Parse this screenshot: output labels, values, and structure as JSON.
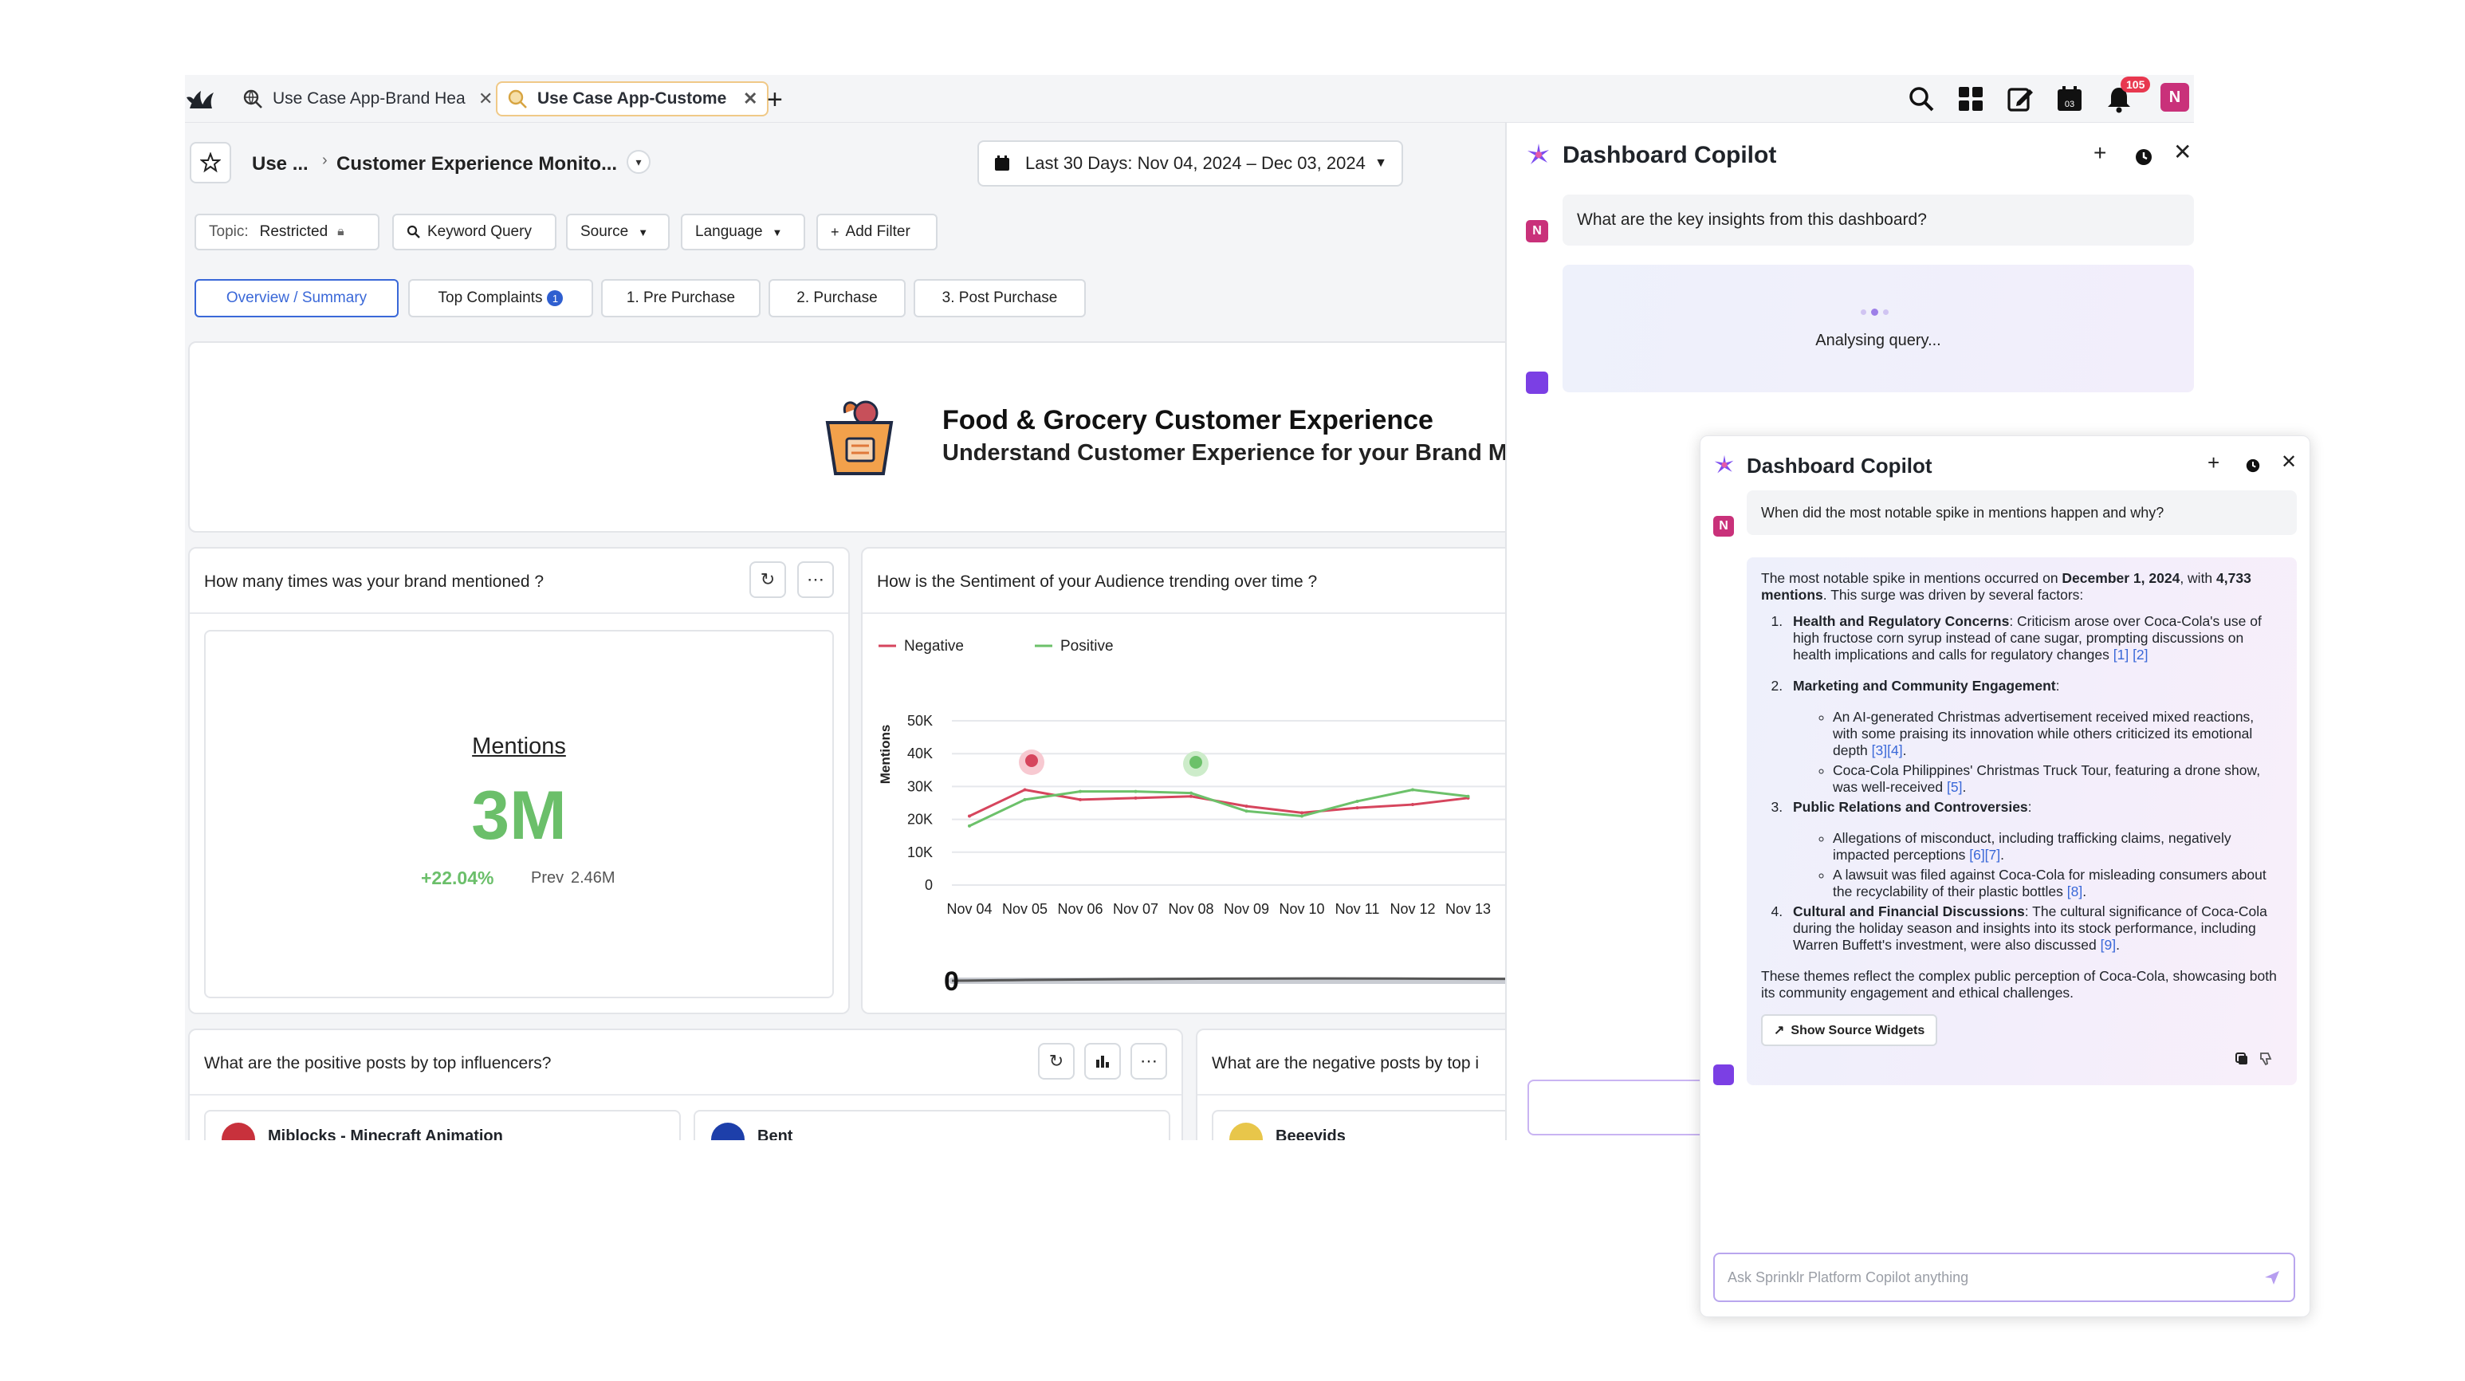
{
  "tabs": [
    {
      "label": "Use Case App-Brand Hea",
      "active": false
    },
    {
      "label": "Use Case App-Custome",
      "active": true
    }
  ],
  "top": {
    "notif_count": "105",
    "avatar": "N",
    "calendar_day": "03"
  },
  "header": {
    "crumb_short": "Use ...",
    "crumb_sep": "›",
    "dashboard_name": "Customer Experience Monito...",
    "date_range": "Last 30 Days: Nov 04, 2024 – Dec 03, 2024"
  },
  "filters": {
    "topic_label": "Topic:",
    "topic_value": "Restricted",
    "keyword": "Keyword Query",
    "source": "Source",
    "language": "Language",
    "add_filter": "Add Filter"
  },
  "view_tabs": [
    {
      "label": "Overview / Summary"
    },
    {
      "label": "Top Complaints",
      "count": "1"
    },
    {
      "label": "1. Pre Purchase"
    },
    {
      "label": "2. Purchase"
    },
    {
      "label": "3. Post Purchase"
    }
  ],
  "banner": {
    "title": "Food & Grocery Customer Experience",
    "subtitle": "Understand Customer Experience for your Brand Me"
  },
  "mentions_card": {
    "title": "How many times was your brand mentioned ?",
    "label": "Mentions",
    "value": "3M",
    "change": "+22.04%",
    "prev_label": "Prev",
    "prev_value": "2.46M"
  },
  "sentiment_card": {
    "title": "How is the Sentiment of your Audience trending over time ?"
  },
  "chart_data": {
    "type": "line",
    "title": "",
    "ylabel": "Mentions",
    "xlabel": "",
    "x": [
      "Nov 04",
      "Nov 05",
      "Nov 06",
      "Nov 07",
      "Nov 08",
      "Nov 09",
      "Nov 10",
      "Nov 11",
      "Nov 12",
      "Nov 13"
    ],
    "ylim": [
      0,
      50000
    ],
    "yticks": [
      "50K",
      "40K",
      "30K",
      "20K",
      "10K",
      "0"
    ],
    "series": [
      {
        "name": "Negative",
        "color": "#d6455d",
        "values": [
          21000,
          29000,
          26000,
          26500,
          27000,
          24000,
          22000,
          23500,
          24500,
          26500
        ]
      },
      {
        "name": "Positive",
        "color": "#6cc16a",
        "values": [
          18000,
          26000,
          28500,
          28500,
          28000,
          22500,
          21000,
          25500,
          29000,
          27000
        ]
      }
    ],
    "range_slider_label": "0"
  },
  "positive_card": {
    "title": "What are the positive posts by top influencers?",
    "posts": [
      "Miblocks - Minecraft Animation",
      "Bent"
    ]
  },
  "negative_card": {
    "title": "What are the negative posts by top i",
    "posts": [
      "Beeevids"
    ]
  },
  "copilot": {
    "title": "Dashboard Copilot",
    "question": "What are the key insights from this dashboard?",
    "status": "Analysing query..."
  },
  "copilot2": {
    "title": "Dashboard Copilot",
    "question": "When did the most notable spike in mentions happen and why?",
    "answer": {
      "intro_a": "The most notable spike in mentions occurred on ",
      "intro_date": "December 1, 2024",
      "intro_b": ", with ",
      "intro_count": "4,733 mentions",
      "intro_c": ". This surge was driven by several factors:",
      "p1_head": "Health and Regulatory Concerns",
      "p1_body": ": Criticism arose over Coca-Cola's use of high fructose corn syrup instead of cane sugar, prompting discussions on health implications and calls for regulatory changes ",
      "p1_refs": "[1] [2]",
      "p2_head": "Marketing and Community Engagement",
      "p2_a": "An AI-generated Christmas advertisement received mixed reactions, with some praising its innovation while others criticized its emotional depth ",
      "p2_a_refs": "[3][4]",
      "p2_b": "Coca-Cola Philippines' Christmas Truck Tour, featuring a drone show, was well-received ",
      "p2_b_refs": "[5]",
      "p3_head": "Public Relations and Controversies",
      "p3_a": "Allegations of misconduct, including trafficking claims, negatively impacted perceptions ",
      "p3_a_refs": "[6][7]",
      "p3_b": "A lawsuit was filed against Coca-Cola for misleading consumers about the recyclability of their plastic bottles ",
      "p3_b_refs": "[8]",
      "p4_head": "Cultural and Financial Discussions",
      "p4_body": ": The cultural significance of Coca-Cola during the holiday season and insights into its stock performance, including Warren Buffett's investment, were also discussed ",
      "p4_refs": "[9]",
      "outro": "These themes reflect the complex public perception of Coca-Cola, showcasing both its community engagement and ethical challenges."
    },
    "show_sources": "Show Source Widgets",
    "ask_placeholder": "Ask Sprinklr Platform Copilot anything"
  }
}
